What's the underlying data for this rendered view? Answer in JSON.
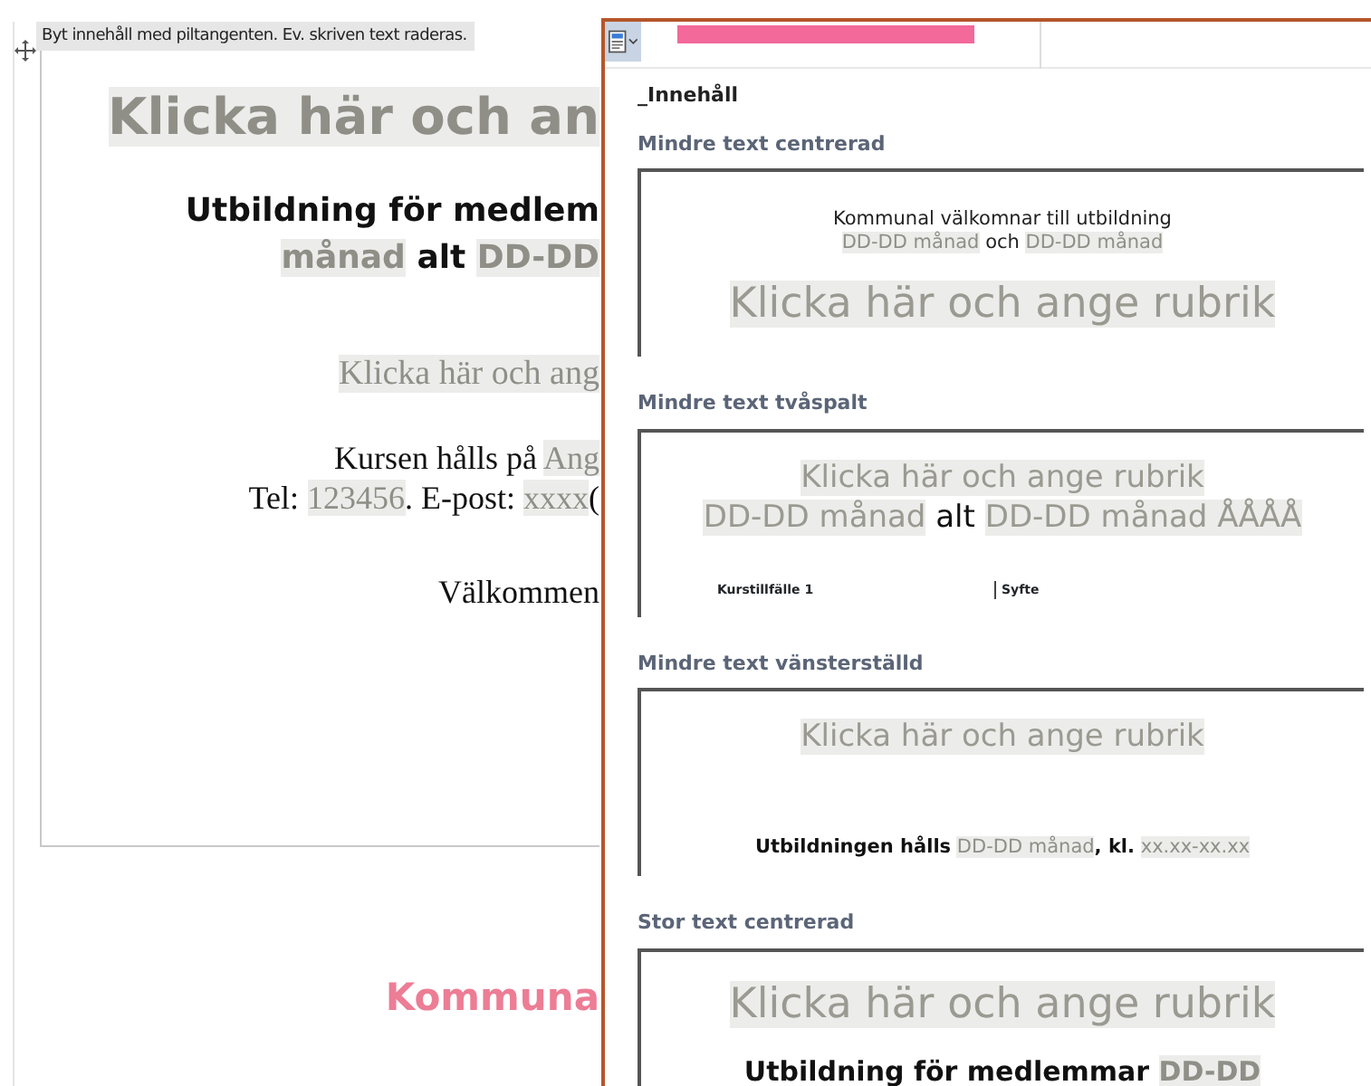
{
  "content_control": {
    "hint": "Byt innehåll med piltangenten. Ev. skriven text raderas."
  },
  "document": {
    "lines": [
      {
        "kind": "heading",
        "segments": [
          {
            "kind": "placeholder",
            "text": "Klicka här och an"
          }
        ]
      },
      {
        "kind": "lead",
        "segments": [
          {
            "kind": "plain",
            "text": "Utbildning för medlem"
          }
        ]
      },
      {
        "kind": "lead",
        "segments": [
          {
            "kind": "placeholder",
            "text": "månad"
          },
          {
            "kind": "plain",
            "text": "alt"
          },
          {
            "kind": "placeholder",
            "text": "DD-DD"
          }
        ]
      },
      {
        "kind": "serif-heading",
        "segments": [
          {
            "kind": "placeholder",
            "text": "Klicka här och ang"
          }
        ]
      },
      {
        "kind": "serif",
        "segments": [
          {
            "kind": "plain",
            "text": "Kursen hålls på"
          },
          {
            "kind": "placeholder",
            "text": "Ang"
          }
        ]
      },
      {
        "kind": "serif",
        "segments": [
          {
            "kind": "plain",
            "text": "Tel:"
          },
          {
            "kind": "placeholder",
            "text": "123456"
          },
          {
            "kind": "plain",
            "text": ". E-post:",
            "joined": true
          },
          {
            "kind": "placeholder",
            "text": "xxxx"
          },
          {
            "kind": "plain",
            "text": "(",
            "joined": true
          }
        ]
      },
      {
        "kind": "serif-gap",
        "segments": [
          {
            "kind": "plain",
            "text": "Välkommen"
          }
        ]
      }
    ],
    "footer": "Kommuna"
  },
  "gallery": {
    "category": "_Innehåll",
    "items": [
      {
        "title": "Mindre text centrerad",
        "preview": [
          {
            "kind": "small",
            "segments": [
              {
                "kind": "plain",
                "text": "Kommunal välkomnar till utbildning"
              }
            ]
          },
          {
            "kind": "small",
            "segments": [
              {
                "kind": "placeholder",
                "text": "DD-DD månad"
              },
              {
                "kind": "plain",
                "text": "och"
              },
              {
                "kind": "placeholder",
                "text": "DD-DD månad"
              }
            ]
          },
          {
            "kind": "big",
            "segments": [
              {
                "kind": "placeholder",
                "text": "Klicka här och ange rubrik"
              }
            ]
          }
        ]
      },
      {
        "title": "Mindre text tvåspalt",
        "preview": [
          {
            "kind": "medium",
            "segments": [
              {
                "kind": "placeholder",
                "text": "Klicka här och ange rubrik"
              }
            ]
          },
          {
            "kind": "medium",
            "segments": [
              {
                "kind": "placeholder",
                "text": "DD-DD månad"
              },
              {
                "kind": "plain",
                "text": "alt"
              },
              {
                "kind": "placeholder",
                "text": "DD-DD månad ÅÅÅÅ"
              }
            ]
          },
          {
            "kind": "columns",
            "cells": [
              "Kurstillfälle 1",
              "Syfte"
            ]
          }
        ]
      },
      {
        "title": "Mindre text vänsterställd",
        "preview": [
          {
            "kind": "medium",
            "segments": [
              {
                "kind": "placeholder",
                "text": "Klicka här och ange rubrik"
              }
            ]
          },
          {
            "kind": "small-low",
            "segments": [
              {
                "kind": "plain",
                "text": "Utbildningen hålls"
              },
              {
                "kind": "placeholder",
                "text": "DD-DD månad"
              },
              {
                "kind": "plain",
                "text": ", kl.",
                "joined": true
              },
              {
                "kind": "placeholder",
                "text": "xx.xx-xx.xx"
              }
            ]
          }
        ]
      },
      {
        "title": "Stor text centrerad",
        "preview": [
          {
            "kind": "big-top",
            "segments": [
              {
                "kind": "placeholder",
                "text": "Klicka här och ange rubrik"
              }
            ]
          },
          {
            "kind": "lead",
            "segments": [
              {
                "kind": "plain",
                "text": "Utbildning för medlemmar"
              },
              {
                "kind": "placeholder",
                "text": "DD-DD"
              }
            ]
          }
        ]
      }
    ]
  }
}
